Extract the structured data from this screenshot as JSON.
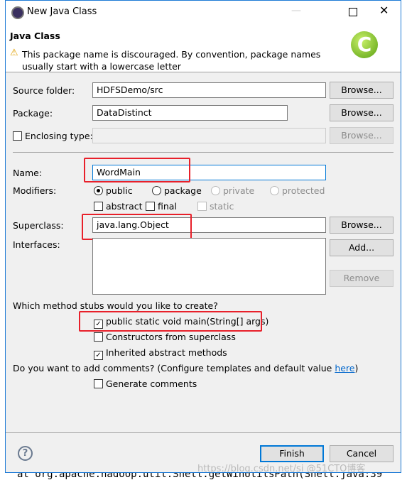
{
  "background": {
    "code_line": "at org.apache.hadoop.util.Shell.getWinUtilsPath(Shell.java:39"
  },
  "watermark": "https://blog.csdn.net/si @51CTO博客",
  "window": {
    "title": "New Java Class"
  },
  "header": {
    "title": "Java Class",
    "warning": "This package name is discouraged. By convention, package names usually start with a lowercase letter"
  },
  "form": {
    "source_folder": {
      "label": "Source folder:",
      "value": "HDFSDemo/src",
      "button": "Browse..."
    },
    "package": {
      "label": "Package:",
      "value": "DataDistinct",
      "button": "Browse..."
    },
    "enclosing": {
      "label": "Enclosing type:",
      "checked": false,
      "value": "",
      "button": "Browse..."
    },
    "name": {
      "label": "Name:",
      "value": "WordMain"
    },
    "modifiers": {
      "label": "Modifiers:",
      "options": [
        "public",
        "package",
        "private",
        "protected"
      ],
      "selected": "public",
      "abstract": "abstract",
      "final": "final",
      "static": "static"
    },
    "superclass": {
      "label": "Superclass:",
      "value": "java.lang.Object",
      "button": "Browse..."
    },
    "interfaces": {
      "label": "Interfaces:",
      "add": "Add...",
      "remove": "Remove"
    },
    "stubs": {
      "question": "Which method stubs would you like to create?",
      "items": [
        {
          "label": "public static void main(String[] args)",
          "checked": true
        },
        {
          "label": "Constructors from superclass",
          "checked": false
        },
        {
          "label": "Inherited abstract methods",
          "checked": true
        }
      ]
    },
    "comments": {
      "question": "Do you want to add comments? (Configure templates and default value ",
      "link": "here",
      "suffix": ")",
      "generate": "Generate comments",
      "checked": false
    }
  },
  "footer": {
    "finish": "Finish",
    "cancel": "Cancel"
  },
  "colors": {
    "accent": "#0078d7",
    "highlight": "#e8202a"
  }
}
